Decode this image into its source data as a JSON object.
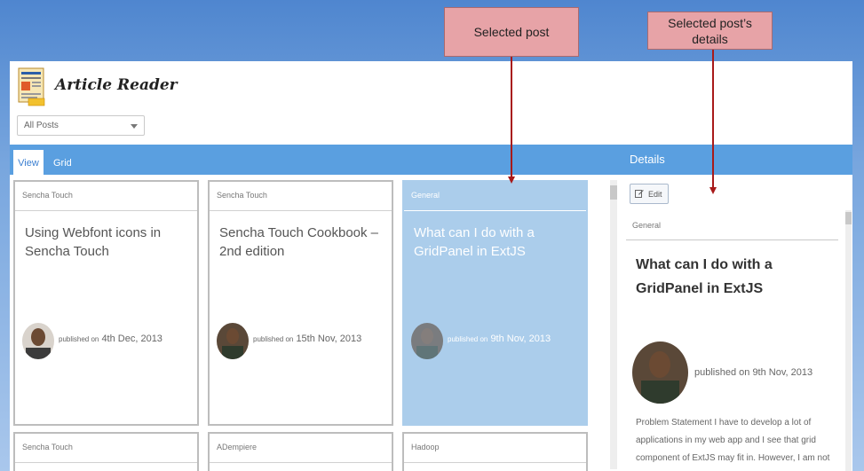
{
  "app": {
    "title": "Article Reader"
  },
  "filter": {
    "selected": "All Posts"
  },
  "tabs": [
    {
      "label": "View"
    },
    {
      "label": "Grid"
    }
  ],
  "details_header": "Details",
  "posts": [
    {
      "category": "Sencha Touch",
      "title": "Using Webfont icons in Sencha Touch",
      "published_prefix": "published on",
      "date": "4th Dec, 2013"
    },
    {
      "category": "Sencha Touch",
      "title": "Sencha Touch Cookbook – 2nd edition",
      "published_prefix": "published on",
      "date": "15th Nov, 2013"
    },
    {
      "category": "General",
      "title": "What can I do with a GridPanel in ExtJS",
      "published_prefix": "published on",
      "date": "9th Nov, 2013"
    }
  ],
  "posts_row2": [
    {
      "category": "Sencha Touch"
    },
    {
      "category": "ADempiere"
    },
    {
      "category": "Hadoop"
    }
  ],
  "details": {
    "edit_label": "Edit",
    "category": "General",
    "title": "What can I do with a GridPanel in ExtJS",
    "published": "published on 9th Nov, 2013",
    "body": "Problem Statement I have to develop a lot of applications in my web app and I see that grid component of ExtJS may fit in. However, I am not"
  },
  "callouts": {
    "selected_post": "Selected post",
    "selected_details": "Selected post’s details"
  },
  "colors": {
    "accent": "#5a9fe0",
    "selected_card": "#abcdeb",
    "callout": "#e7a3a7",
    "arrow": "#a81a1a"
  }
}
